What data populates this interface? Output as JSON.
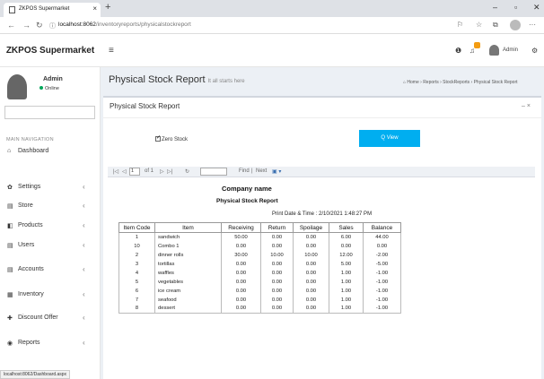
{
  "browser": {
    "tab_title": "ZKPOS Supermarket",
    "tab_close": "×",
    "new_tab": "+",
    "url_host": "localhost:8062",
    "url_path": "/inventoryreports/physicalstockreport",
    "win_min": "–",
    "win_max": "▫",
    "win_close": "✕",
    "more": "···"
  },
  "header": {
    "brand": "ZKPOS Supermarket",
    "user_label": "Admin"
  },
  "sidebar": {
    "user_name": "Admin",
    "status": "Online",
    "nav_label": "MAIN NAVIGATION",
    "items": [
      {
        "label": "Dashboard",
        "icon": "dashboard-icon",
        "glyph": "⌂",
        "chevron": ""
      },
      {
        "label": "Settings",
        "icon": "gear-icon",
        "glyph": "✿",
        "chevron": "‹"
      },
      {
        "label": "Store",
        "icon": "store-icon",
        "glyph": "▤",
        "chevron": "‹"
      },
      {
        "label": "Products",
        "icon": "products-icon",
        "glyph": "◧",
        "chevron": "‹"
      },
      {
        "label": "Users",
        "icon": "users-icon",
        "glyph": "▤",
        "chevron": "‹"
      },
      {
        "label": "Accounts",
        "icon": "accounts-icon",
        "glyph": "▤",
        "chevron": "‹"
      },
      {
        "label": "Inventory",
        "icon": "inventory-icon",
        "glyph": "▦",
        "chevron": "‹"
      },
      {
        "label": "Discount Offer",
        "icon": "plus-icon",
        "glyph": "✚",
        "chevron": "‹"
      },
      {
        "label": "Reports",
        "icon": "eye-icon",
        "glyph": "◉",
        "chevron": "‹"
      }
    ]
  },
  "status_url": "localhost:8062/Dashboard.aspx",
  "page": {
    "title": "Physical Stock Report",
    "subtitle": "It all starts here",
    "breadcrumb": "⌂ Home  ›  Reports  ›  StockReports  ›  Physical Stock Report"
  },
  "box": {
    "title": "Physical Stock Report",
    "tools": "–  ×",
    "zero_stock_label": "Zero Stock",
    "view_label": "Q View"
  },
  "viewer": {
    "first": "|◁",
    "prev": "◁",
    "page": "1",
    "of": "of 1",
    "next": "▷",
    "last": "▷|",
    "refresh": "↻",
    "find": "Find",
    "sep": "|",
    "next_find": "Next",
    "export": "▣ ▾"
  },
  "report": {
    "company": "Company name",
    "title": "Physical Stock Report",
    "print_date": "Print Date & Time : 2/10/2021 1:48:27 PM",
    "columns": [
      "Item Code",
      "Item",
      "Receiving",
      "Return",
      "Spoilage",
      "Sales",
      "Balance"
    ],
    "rows": [
      [
        "1",
        "sandwich",
        "50.00",
        "0.00",
        "0.00",
        "6.00",
        "44.00"
      ],
      [
        "10",
        "Combo 1",
        "0.00",
        "0.00",
        "0.00",
        "0.00",
        "0.00"
      ],
      [
        "2",
        "dinner rolls",
        "30.00",
        "10.00",
        "10.00",
        "12.00",
        "-2.00"
      ],
      [
        "3",
        "tortillas",
        "0.00",
        "0.00",
        "0.00",
        "5.00",
        "-5.00"
      ],
      [
        "4",
        "waffles",
        "0.00",
        "0.00",
        "0.00",
        "1.00",
        "-1.00"
      ],
      [
        "5",
        "vegetables",
        "0.00",
        "0.00",
        "0.00",
        "1.00",
        "-1.00"
      ],
      [
        "6",
        "ice cream",
        "0.00",
        "0.00",
        "0.00",
        "1.00",
        "-1.00"
      ],
      [
        "7",
        "seafood",
        "0.00",
        "0.00",
        "0.00",
        "1.00",
        "-1.00"
      ],
      [
        "8",
        "dessert",
        "0.00",
        "0.00",
        "0.00",
        "1.00",
        "-1.00"
      ]
    ]
  }
}
